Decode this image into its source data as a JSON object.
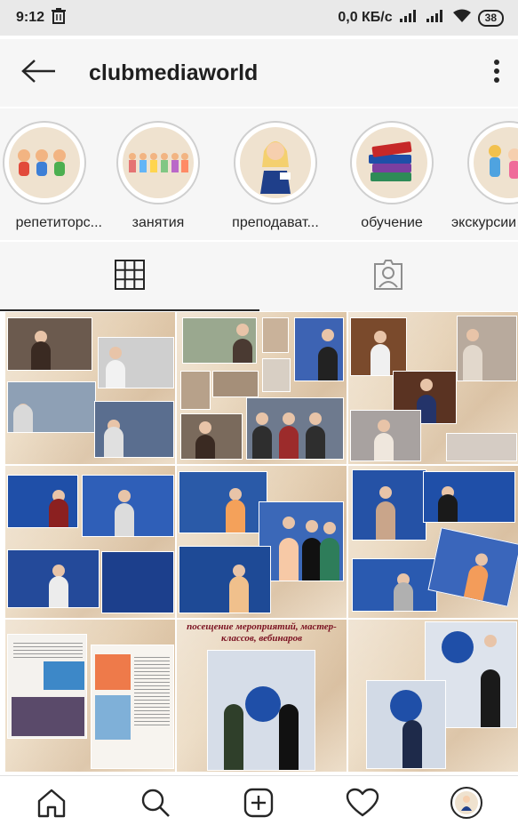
{
  "status_bar": {
    "time": "9:12",
    "network_speed": "0,0 КБ/с",
    "battery": "38"
  },
  "header": {
    "username": "clubmediaworld",
    "back_icon": "back-arrow-icon",
    "menu_icon": "more-vertical-icon"
  },
  "highlights": [
    {
      "label": "репетиторс...",
      "icon": "kids-icon"
    },
    {
      "label": "занятия",
      "icon": "children-row-icon"
    },
    {
      "label": "преподават...",
      "icon": "teacher-icon"
    },
    {
      "label": "обучение",
      "icon": "books-icon"
    },
    {
      "label": "экскурсии",
      "icon": "excursion-icon"
    }
  ],
  "tabs": [
    {
      "name": "grid",
      "icon": "grid-icon",
      "active": true
    },
    {
      "name": "tagged",
      "icon": "tagged-person-icon",
      "active": false
    }
  ],
  "posts": [
    {
      "id": "post-1",
      "caption": ""
    },
    {
      "id": "post-2",
      "caption": ""
    },
    {
      "id": "post-3",
      "caption": ""
    },
    {
      "id": "post-4",
      "caption": ""
    },
    {
      "id": "post-5",
      "caption": ""
    },
    {
      "id": "post-6",
      "caption": ""
    },
    {
      "id": "post-7",
      "caption": ""
    },
    {
      "id": "post-8",
      "caption": "посещение мероприятий, мастер-классов, вебинаров"
    },
    {
      "id": "post-9",
      "caption": ""
    }
  ],
  "bottom_nav": [
    {
      "name": "home",
      "icon": "home-icon"
    },
    {
      "name": "search",
      "icon": "search-icon"
    },
    {
      "name": "new-post",
      "icon": "add-post-icon"
    },
    {
      "name": "activity",
      "icon": "heart-icon"
    },
    {
      "name": "profile",
      "icon": "profile-avatar-icon"
    }
  ],
  "colors": {
    "collage_background": "#ead9c2",
    "studio_blue": "#1f4fa8",
    "text_primary": "#262626"
  }
}
